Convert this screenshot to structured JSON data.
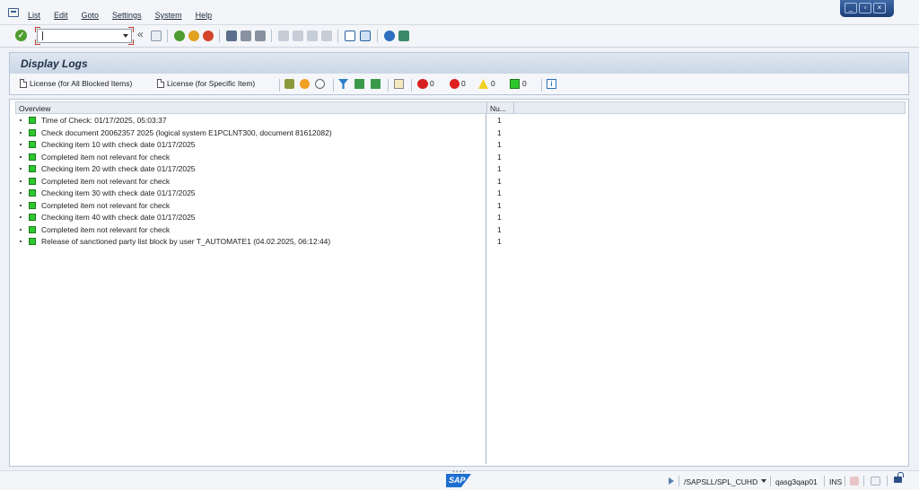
{
  "menu": {
    "items": [
      "List",
      "Edit",
      "Goto",
      "Settings",
      "System",
      "Help"
    ]
  },
  "command_field": {
    "value": ""
  },
  "title": "Display Logs",
  "app_toolbar": {
    "btn_license_all": "License (for All Blocked Items)",
    "btn_license_specific": "License (for Specific Item)",
    "count_stop": "0",
    "count_error": "0",
    "count_warning": "0",
    "count_success": "0"
  },
  "table": {
    "columns": [
      "Overview",
      "Nu..."
    ],
    "rows": [
      {
        "text": "Time of Check: 01/17/2025, 05:03:37",
        "num": "1"
      },
      {
        "text": "Check document 20062357 2025 (logical system E1PCLNT300, document 81612082)",
        "num": "1"
      },
      {
        "text": "Checking item 10 with check date 01/17/2025",
        "num": "1"
      },
      {
        "text": "Completed item not relevant for check",
        "num": "1"
      },
      {
        "text": "Checking item 20 with check date 01/17/2025",
        "num": "1"
      },
      {
        "text": "Completed item not relevant for check",
        "num": "1"
      },
      {
        "text": "Checking item 30 with check date 01/17/2025",
        "num": "1"
      },
      {
        "text": "Completed item not relevant for check",
        "num": "1"
      },
      {
        "text": "Checking item 40 with check date 01/17/2025",
        "num": "1"
      },
      {
        "text": "Completed item not relevant for check",
        "num": "1"
      },
      {
        "text": "Release of sanctioned party list block by user T_AUTOMATE1 (04.02.2025, 06:12:44)",
        "num": "1"
      }
    ]
  },
  "status": {
    "sap_logo": "SAP",
    "transaction": "/SAPSLL/SPL_CUHD",
    "server": "qasg3qap01",
    "mode": "INS"
  },
  "colors": {
    "status_green": "#2ec82e",
    "accent_blue": "#1d6fd1"
  }
}
